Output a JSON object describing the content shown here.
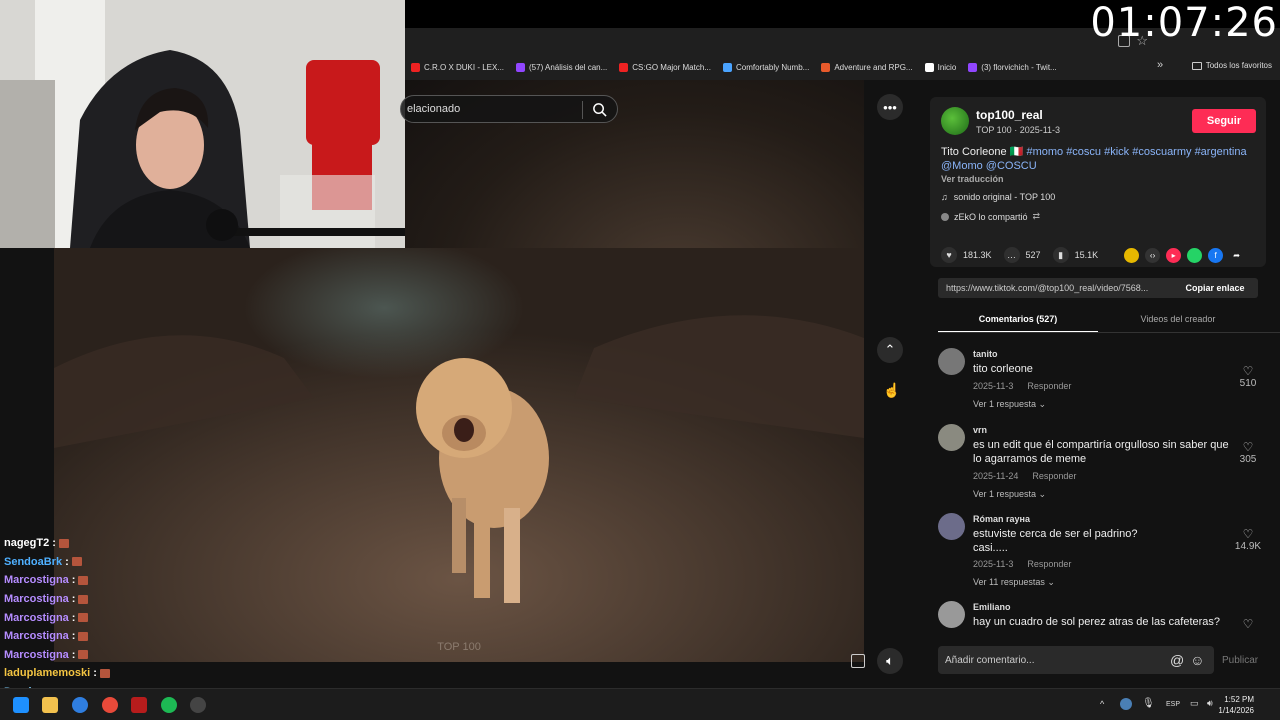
{
  "overlay": {
    "timer": "01:07:26"
  },
  "bookmarks": [
    {
      "label": "C.R.O X DUKI - LEX...",
      "color": "#e22"
    },
    {
      "label": "(57) Análisis del can...",
      "color": "#9146ff"
    },
    {
      "label": "CS:GO Major Match...",
      "color": "#e22"
    },
    {
      "label": "Comfortably Numb...",
      "color": "#4aa3ff"
    },
    {
      "label": "Adventure and RPG...",
      "color": "#e85a2b"
    },
    {
      "label": "Inicio",
      "color": "#fff"
    },
    {
      "label": "(3) florvichich - Twit...",
      "color": "#9146ff"
    }
  ],
  "bookmarks_all": "Todos los favoritos",
  "search": {
    "text": "elacionado"
  },
  "chat": [
    {
      "user": "nagegT2",
      "color": "#ffffff"
    },
    {
      "user": "SendoaBrk",
      "color": "#4fb0ff"
    },
    {
      "user": "Marcostigna",
      "color": "#b58cff"
    },
    {
      "user": "Marcostigna",
      "color": "#b58cff"
    },
    {
      "user": "Marcostigna",
      "color": "#b58cff"
    },
    {
      "user": "Marcostigna",
      "color": "#b58cff"
    },
    {
      "user": "Marcostigna",
      "color": "#b58cff"
    },
    {
      "user": "laduplamemoski",
      "color": "#f4c542"
    },
    {
      "user": "Darsic",
      "color": "#7fd0ff"
    }
  ],
  "video": {
    "watermark": "TOP 100"
  },
  "post": {
    "username": "top100_real",
    "meta": "TOP 100 · 2025-11-3",
    "follow_label": "Seguir",
    "caption_plain": "Tito Corleone ",
    "caption_tags": "#momo #coscu #kick #coscuarmy #argentina @Momo @COSCU",
    "translate_label": "Ver traducción",
    "sound": "sonido original - TOP 100",
    "shared_by": "zEkO lo compartió",
    "likes": "181.3K",
    "comments": "527",
    "saves": "15.1K",
    "link": "https://www.tiktok.com/@top100_real/video/7568...",
    "copy_label": "Copiar enlace"
  },
  "tabs": {
    "comments": "Comentarios (527)",
    "creator_videos": "Videos del creador"
  },
  "comments": [
    {
      "user": "tanito",
      "text": "tito corleone",
      "date": "2025-11-3",
      "reply": "Responder",
      "replies": "Ver 1 respuesta",
      "likes": "510"
    },
    {
      "user": "vrn",
      "text": "es un edit que él compartiría orgulloso sin saber que lo agarramos de meme",
      "date": "2025-11-24",
      "reply": "Responder",
      "replies": "Ver 1 respuesta",
      "likes": "305"
    },
    {
      "user": "Róman raуна",
      "text": "estuviste cerca de ser el padrino?\ncasi.....",
      "date": "2025-11-3",
      "reply": "Responder",
      "replies": "Ver 11 respuestas",
      "likes": "14.9K"
    },
    {
      "user": "Emiliano",
      "text": "hay un cuadro de sol perez atras de las cafeteras?",
      "date": "",
      "reply": "",
      "replies": "",
      "likes": ""
    }
  ],
  "comment_input": {
    "placeholder": "Añadir comentario...",
    "publish": "Publicar"
  },
  "taskbar": {
    "lang": "ESP",
    "time": "1:52 PM",
    "date": "1/14/2026"
  }
}
